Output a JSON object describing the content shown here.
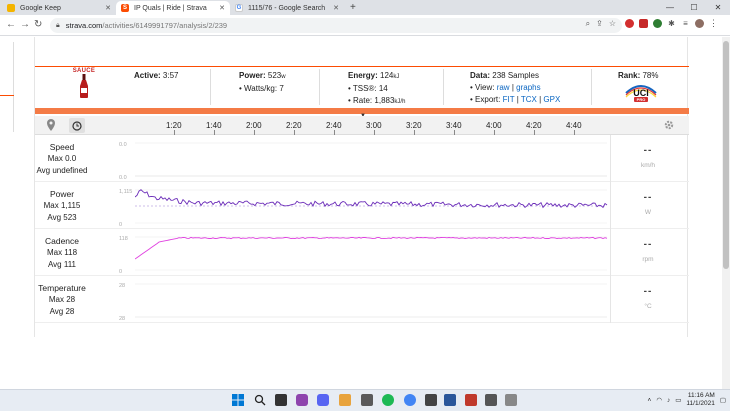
{
  "browser": {
    "tabs": [
      {
        "title": "Google Keep",
        "icon": "keep-icon"
      },
      {
        "title": "IP Quals | Ride | Strava",
        "icon": "strava-icon"
      },
      {
        "title": "1115/76 - Google Search",
        "icon": "google-icon"
      }
    ],
    "new_tab": "+",
    "window_controls": {
      "minimize": "—",
      "maximize": "☐",
      "close": "✕"
    },
    "url_host": "strava.com",
    "url_path": "/activities/6149991797/analysis/2/239"
  },
  "stats": {
    "sauce_label": "SAUCE",
    "active_label": "Active:",
    "active_value": "3:57",
    "power_label": "Power:",
    "power_value": "523",
    "power_unit": "w",
    "wkg_label": "Watts/kg:",
    "wkg_value": "7",
    "energy_label": "Energy:",
    "energy_value": "124",
    "energy_unit": "kJ",
    "tss_label": "TSS®:",
    "tss_value": "14",
    "rate_label": "Rate:",
    "rate_value": "1,883",
    "rate_unit": "kJ/h",
    "data_label": "Data:",
    "data_value": "238 Samples",
    "view_label": "View:",
    "view_raw": "raw",
    "view_sep": "|",
    "view_graphs": "graphs",
    "export_label": "Export:",
    "export_fit": "FIT",
    "export_tcx": "TCX",
    "export_gpx": "GPX",
    "rank_label": "Rank:",
    "rank_value": "78%",
    "rank_logo_text": "UCI",
    "rank_logo_sub": "PRO"
  },
  "timeline": {
    "ticks": [
      "1:20",
      "1:40",
      "2:00",
      "2:20",
      "2:40",
      "3:00",
      "3:20",
      "3:40",
      "4:00",
      "4:20",
      "4:40"
    ]
  },
  "rows": [
    {
      "name": "Speed",
      "max": "Max 0.0",
      "avg": "Avg undefined",
      "value": "--",
      "unit": "km/h",
      "axis_top": "0.0",
      "axis_bottom": "0.0"
    },
    {
      "name": "Power",
      "max": "Max 1,115",
      "avg": "Avg 523",
      "value": "--",
      "unit": "W",
      "axis_top": "1,115",
      "axis_bottom": "0"
    },
    {
      "name": "Cadence",
      "max": "Max 118",
      "avg": "Avg 111",
      "value": "--",
      "unit": "rpm",
      "axis_top": "118",
      "axis_bottom": "0"
    },
    {
      "name": "Temperature",
      "max": "Max 28",
      "avg": "Avg 28",
      "value": "--",
      "unit": "°C",
      "axis_top": "28",
      "axis_bottom": "28"
    }
  ],
  "colors": {
    "strava_orange": "#fc4c02",
    "power_line": "#6a2bb8",
    "cadence_line": "#e040e0",
    "link": "#0a66c2"
  },
  "tray": {
    "time": "11:16 AM",
    "date": "11/1/2021"
  }
}
